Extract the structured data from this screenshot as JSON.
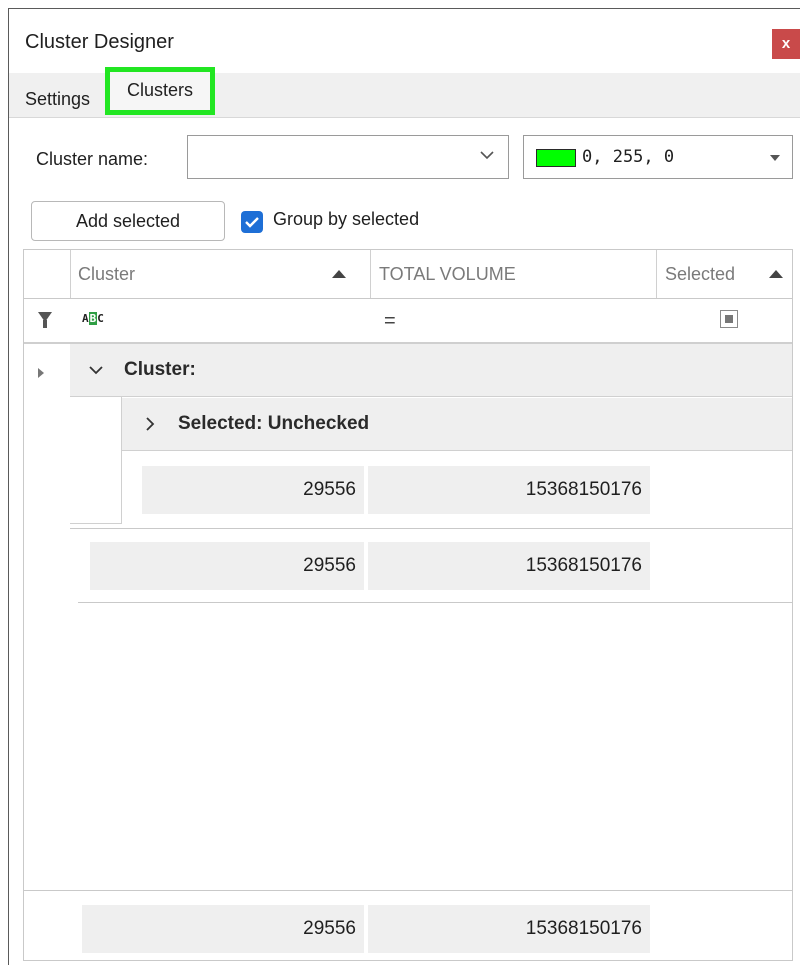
{
  "window": {
    "title": "Cluster Designer",
    "close_label": "x"
  },
  "tabs": [
    {
      "label": "Settings"
    },
    {
      "label": "Clusters"
    }
  ],
  "options": {
    "cluster_name_label": "Cluster name:",
    "cluster_name_value": "",
    "color_hex": "#00ff00",
    "color_text": "0, 255, 0",
    "add_selected_label": "Add selected",
    "group_by_selected_label": "Group by selected",
    "group_by_selected_checked": true
  },
  "grid": {
    "columns": [
      "Cluster",
      "TOTAL VOLUME",
      "Selected"
    ],
    "filter_cluster_icon": "abc-icon",
    "filter_volume_operator": "=",
    "group_cluster_label": "Cluster:",
    "group_selected_label": "Selected: Unchecked",
    "subgroup_summary": {
      "cluster": "29556",
      "volume": "15368150176"
    },
    "group_summary": {
      "cluster": "29556",
      "volume": "15368150176"
    },
    "total_summary": {
      "cluster": "29556",
      "volume": "15368150176"
    }
  },
  "icons": {
    "close": "close-icon",
    "dropdown": "chevron-down-icon",
    "filter": "filter-icon",
    "sort": "sort-ascending-icon"
  }
}
